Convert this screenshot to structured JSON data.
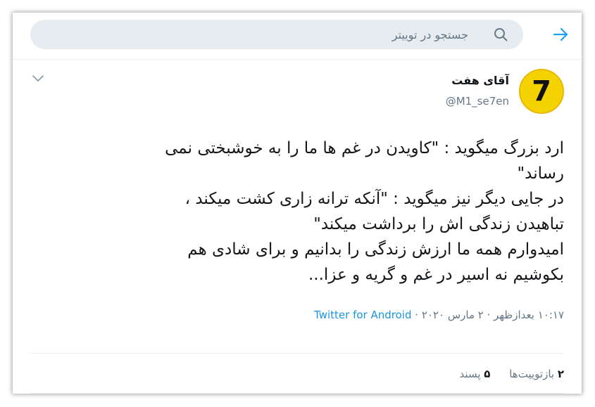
{
  "header": {
    "search_placeholder": "جستجو در توییتر"
  },
  "tweet": {
    "display_name": "آقای هفت",
    "handle": "@M1_se7en",
    "avatar_text": "7",
    "avatar_color": "#f5d300",
    "text_lines": [
      "ارد بزرگ میگوید : \"کاویدن در غم ها ما را به خوشبختی نمی",
      "رساند\"",
      "در جایی دیگر نیز میگوید : \"آنکه ترانه زاری کشت میکند ،",
      "تباهیدن زندگی اش را برداشت میکند\"",
      " امیدوارم همه ما ارزش زندگی را بدانیم و برای شادی هم",
      "بکوشیم نه اسیر در غم و گریه و عزا..."
    ],
    "timestamp": "۱۰:۱۷ بعدازظهر · ۲ مارس ۲۰۲۰",
    "separator": "·",
    "source": "Twitter for Android",
    "retweets_count": "۲",
    "retweets_label": "بازتوییت‌ها",
    "likes_count": "۵",
    "likes_label": "پسند"
  },
  "colors": {
    "accent": "#1da1f2",
    "link": "#1b95e0",
    "secondary_text": "#657786",
    "primary_text": "#14171a",
    "search_bg": "#e6ecf0"
  },
  "icons": {
    "back": "arrow-right-icon",
    "search": "search-icon",
    "caret": "chevron-down-icon"
  }
}
